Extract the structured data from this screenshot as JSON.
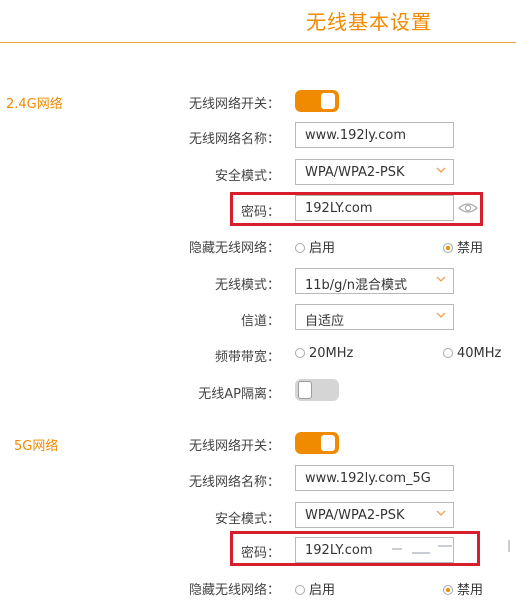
{
  "page": {
    "title": "无线基本设置"
  },
  "colors": {
    "accent": "#f08a00",
    "highlight_border": "#d81e2c"
  },
  "band24": {
    "section": "2.4G网络",
    "switch_label": "无线网络开关：",
    "switch_on": true,
    "ssid_label": "无线网络名称：",
    "ssid": "www.192ly.com",
    "security_label": "安全模式：",
    "security": "WPA/WPA2-PSK",
    "password_label": "密码：",
    "password": "192LY.com",
    "hide_label": "隐藏无线网络：",
    "hide_enable": "启用",
    "hide_disable": "禁用",
    "hide_selected": "禁用",
    "mode_label": "无线模式：",
    "mode": "11b/g/n混合模式",
    "channel_label": "信道：",
    "channel": "自适应",
    "bandwidth_label": "频带带宽：",
    "bw_20": "20MHz",
    "bw_40": "40MHz",
    "ap_isolation_label": "无线AP隔离：",
    "ap_isolation_on": false
  },
  "band5": {
    "section": "5G网络",
    "switch_label": "无线网络开关：",
    "switch_on": true,
    "ssid_label": "无线网络名称：",
    "ssid": "www.192ly.com_5G",
    "security_label": "安全模式：",
    "security": "WPA/WPA2-PSK",
    "password_label": "密码：",
    "password": "192LY.com",
    "hide_label": "隐藏无线网络：",
    "hide_enable": "启用",
    "hide_disable": "禁用",
    "hide_selected": "禁用"
  },
  "icons": {
    "password_toggle": "eye-icon",
    "dropdown": "chevron-down-icon"
  }
}
